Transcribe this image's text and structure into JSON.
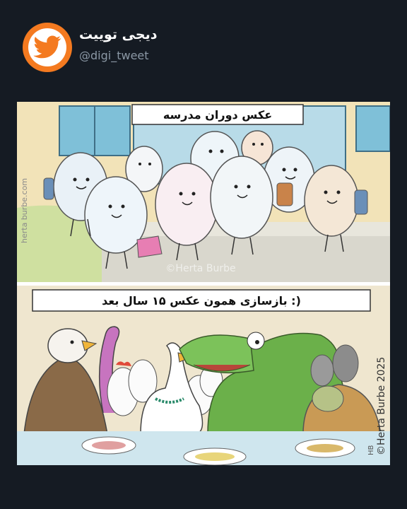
{
  "account": {
    "display_name": "دیجی توییت",
    "handle": "@digi_tweet"
  },
  "comic": {
    "top_caption": "عکس دوران مدرسه",
    "bottom_caption": "بازسازی همون عکس ۱۵ سال بعد :)",
    "watermark_side": "herta burbe.com",
    "credit": "©Herta Burbe 2025",
    "faint_watermark": "©Herta Burbe",
    "signature": "HB"
  },
  "colors": {
    "background": "#151b23",
    "avatar": "#f47a20",
    "name": "#ffffff",
    "handle": "#8b98a5"
  }
}
